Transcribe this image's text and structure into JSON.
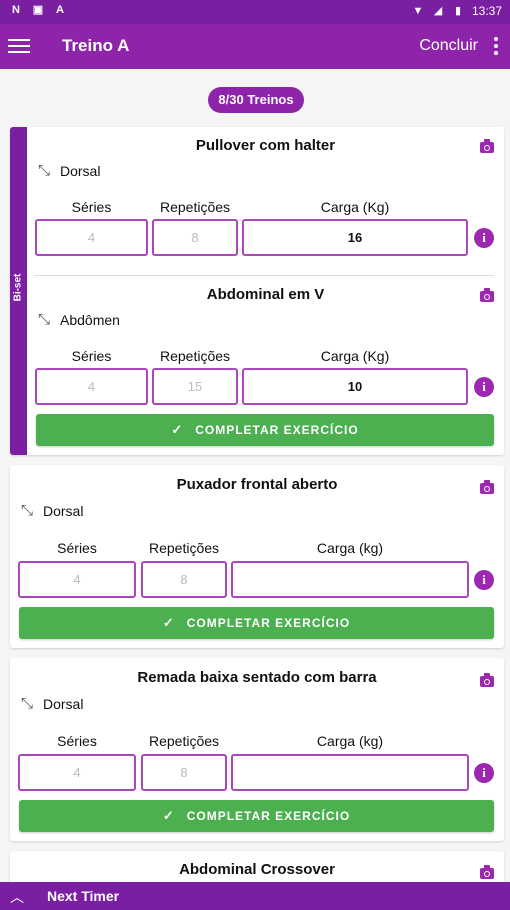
{
  "statusbar": {
    "time": "13:37",
    "left_icons": [
      "N",
      "▣",
      "A"
    ],
    "right_icons": [
      "wifi-icon",
      "signal-icon",
      "battery-icon"
    ]
  },
  "appbar": {
    "title": "Treino A",
    "action": "Concluir"
  },
  "badge": "8/30 Treinos",
  "biset_label": "Bi-set",
  "columns": {
    "series": "Séries",
    "reps": "Repetições",
    "load_kg_upper": "Carga (Kg)",
    "load_kg_lower": "Carga (kg)"
  },
  "complete_button": "COMPLETAR EXERCÍCIO",
  "exercises": [
    {
      "name": "Pullover com halter",
      "muscle": "Dorsal",
      "series": "4",
      "reps": "8",
      "load": "16"
    },
    {
      "name": "Abdominal em V",
      "muscle": "Abdômen",
      "series": "4",
      "reps": "15",
      "load": "10"
    },
    {
      "name": "Puxador frontal aberto",
      "muscle": "Dorsal",
      "series": "4",
      "reps": "8",
      "load": ""
    },
    {
      "name": "Remada baixa sentado com barra",
      "muscle": "Dorsal",
      "series": "4",
      "reps": "8",
      "load": ""
    },
    {
      "name": "Abdominal Crossover"
    }
  ],
  "bottombar": {
    "label": "Next Timer"
  },
  "colors": {
    "primary": "#8e24aa",
    "dark": "#7b1fa2",
    "success": "#4caf50"
  }
}
